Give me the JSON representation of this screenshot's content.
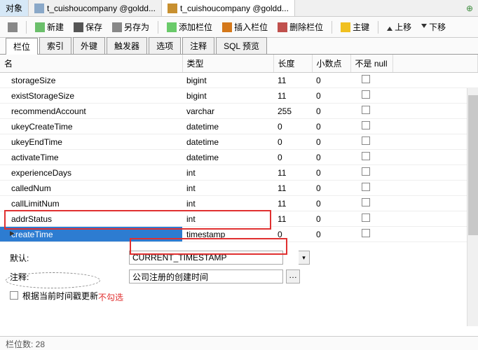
{
  "top_tabs": {
    "obj": "对象",
    "t1": "t_cuishoucompany @goldd...",
    "t2": "t_cuishoucompany @goldd..."
  },
  "toolbar": {
    "new": "新建",
    "save": "保存",
    "saveas": "另存为",
    "addcol": "添加栏位",
    "inscol": "插入栏位",
    "delcol": "删除栏位",
    "key": "主键",
    "up": "上移",
    "down": "下移"
  },
  "sub_tabs": {
    "fields": "栏位",
    "indexes": "索引",
    "fk": "外键",
    "triggers": "触发器",
    "options": "选项",
    "comment": "注释",
    "sql": "SQL 预览"
  },
  "columns": {
    "name": "名",
    "type": "类型",
    "len": "长度",
    "dec": "小数点",
    "null": "不是 null"
  },
  "rows": [
    {
      "name": "storageSize",
      "type": "bigint",
      "len": "11",
      "dec": "0"
    },
    {
      "name": "existStorageSize",
      "type": "bigint",
      "len": "11",
      "dec": "0"
    },
    {
      "name": "recommendAccount",
      "type": "varchar",
      "len": "255",
      "dec": "0"
    },
    {
      "name": "ukeyCreateTime",
      "type": "datetime",
      "len": "0",
      "dec": "0"
    },
    {
      "name": "ukeyEndTime",
      "type": "datetime",
      "len": "0",
      "dec": "0"
    },
    {
      "name": "activateTime",
      "type": "datetime",
      "len": "0",
      "dec": "0"
    },
    {
      "name": "experienceDays",
      "type": "int",
      "len": "11",
      "dec": "0"
    },
    {
      "name": "calledNum",
      "type": "int",
      "len": "11",
      "dec": "0"
    },
    {
      "name": "callLimitNum",
      "type": "int",
      "len": "11",
      "dec": "0"
    },
    {
      "name": "addrStatus",
      "type": "int",
      "len": "11",
      "dec": "0"
    },
    {
      "name": "createTime",
      "type": "timestamp",
      "len": "0",
      "dec": "0",
      "selected": true
    }
  ],
  "props": {
    "default_label": "默认:",
    "default_value": "CURRENT_TIMESTAMP",
    "comment_label": "注释:",
    "comment_value": "公司注册的创建时间",
    "on_update_label": "根据当前时间戳更新"
  },
  "annotation": "不勾选",
  "status": "栏位数: 28"
}
